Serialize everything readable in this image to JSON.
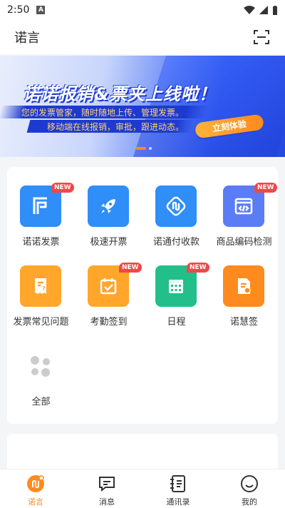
{
  "status_bar": {
    "time": "2:50",
    "notif_letter": "A"
  },
  "header": {
    "title": "诺言"
  },
  "banner": {
    "title": "诺诺报销&票夹上线啦！",
    "line1": "您的发票管家，随时随地上传、管理发票。",
    "line2": "移动端在线报销，审批，跟进动态。",
    "cta": "立刻体验"
  },
  "grid": [
    {
      "label": "诺诺发票",
      "icon": "invoice-f-icon",
      "color": "#2f8ef7",
      "new": "NEW"
    },
    {
      "label": "极速开票",
      "icon": "rocket-icon",
      "color": "#2f8ef7",
      "new": ""
    },
    {
      "label": "诺通付收款",
      "icon": "payment-icon",
      "color": "#2f8ef7",
      "new": ""
    },
    {
      "label": "商品编码检测",
      "icon": "code-check-icon",
      "color": "#5a7cf5",
      "new": "NEW"
    },
    {
      "label": "发票常见问题",
      "icon": "faq-invoice-icon",
      "color": "#ffa62b",
      "new": ""
    },
    {
      "label": "考勤签到",
      "icon": "attendance-icon",
      "color": "#ffa62b",
      "new": "NEW"
    },
    {
      "label": "日程",
      "icon": "calendar-icon",
      "color": "#22bf8a",
      "new": "NEW"
    },
    {
      "label": "诺慧签",
      "icon": "sign-icon",
      "color": "#ff8a1e",
      "new": ""
    },
    {
      "label": "全部",
      "icon": "all-apps-icon",
      "color": "#cccccc",
      "new": ""
    }
  ],
  "tabs": [
    {
      "label": "诺言",
      "icon": "nuoyan-icon",
      "active": true
    },
    {
      "label": "消息",
      "icon": "message-icon",
      "active": false
    },
    {
      "label": "通讯录",
      "icon": "contacts-icon",
      "active": false
    },
    {
      "label": "我的",
      "icon": "me-icon",
      "active": false
    }
  ],
  "colors": {
    "accent": "#ff8a1e",
    "primary_blue": "#2f5bf2"
  }
}
